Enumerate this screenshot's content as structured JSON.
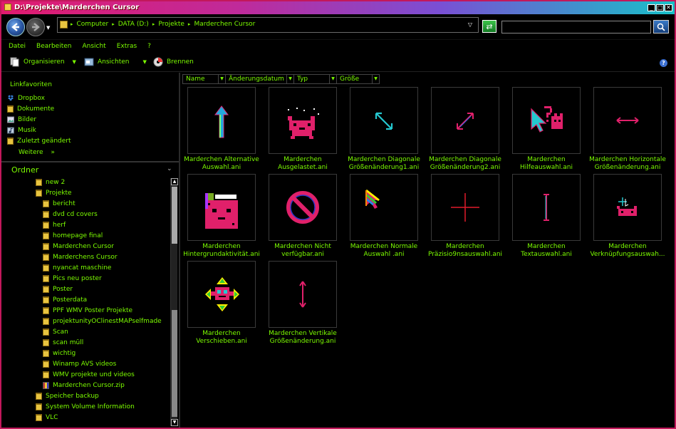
{
  "window": {
    "title": "D:\\Projekte\\Marderchen Cursor",
    "controls": [
      "_",
      "□",
      "✕"
    ]
  },
  "address": {
    "crumbs": [
      "Computer",
      "DATA (D:)",
      "Projekte",
      "Marderchen Cursor"
    ],
    "search_placeholder": ""
  },
  "menu": [
    "Datei",
    "Bearbeiten",
    "Ansicht",
    "Extras",
    "?"
  ],
  "toolbar": {
    "organize": "Organisieren",
    "views": "Ansichten",
    "burn": "Brennen"
  },
  "favorites": {
    "title": "Linkfavoriten",
    "items": [
      "Dropbox",
      "Dokumente",
      "Bilder",
      "Musik",
      "Zuletzt geändert"
    ],
    "more": "Weitere",
    "more_arrow": "»"
  },
  "folders_title": "Ordner",
  "tree": [
    {
      "label": "new 2",
      "level": 1,
      "icon": "folder-icon"
    },
    {
      "label": "Projekte",
      "level": 1,
      "icon": "folder-icon"
    },
    {
      "label": "bericht",
      "level": 2,
      "icon": "folder-icon"
    },
    {
      "label": "dvd cd covers",
      "level": 2,
      "icon": "folder-icon"
    },
    {
      "label": "herf",
      "level": 2,
      "icon": "folder-icon"
    },
    {
      "label": "homepage final",
      "level": 2,
      "icon": "folder-icon"
    },
    {
      "label": "Marderchen Cursor",
      "level": 2,
      "icon": "folder-icon"
    },
    {
      "label": "Marderchens Cursor",
      "level": 2,
      "icon": "folder-icon"
    },
    {
      "label": "nyancat maschine",
      "level": 2,
      "icon": "folder-icon"
    },
    {
      "label": "Pics neu poster",
      "level": 2,
      "icon": "folder-icon"
    },
    {
      "label": "Poster",
      "level": 2,
      "icon": "folder-icon"
    },
    {
      "label": "Posterdata",
      "level": 2,
      "icon": "folder-icon"
    },
    {
      "label": "PPF WMV Poster Projekte",
      "level": 2,
      "icon": "folder-icon"
    },
    {
      "label": "projektunityOClinestMAPselfmade",
      "level": 2,
      "icon": "folder-icon"
    },
    {
      "label": "Scan",
      "level": 2,
      "icon": "folder-icon"
    },
    {
      "label": "scan müll",
      "level": 2,
      "icon": "folder-icon"
    },
    {
      "label": "wichtig",
      "level": 2,
      "icon": "folder-icon"
    },
    {
      "label": "Winamp AVS videos",
      "level": 2,
      "icon": "folder-icon"
    },
    {
      "label": "WMV projekte und videos",
      "level": 2,
      "icon": "folder-icon"
    },
    {
      "label": "Marderchen Cursor.zip",
      "level": 2,
      "icon": "zip-icon"
    },
    {
      "label": "Speicher backup",
      "level": 1,
      "icon": "folder-icon"
    },
    {
      "label": "System Volume Information",
      "level": 1,
      "icon": "folder-icon"
    },
    {
      "label": "VLC",
      "level": 1,
      "icon": "folder-icon"
    }
  ],
  "columns": [
    "Name",
    "Änderungsdatum",
    "Typ",
    "Größe"
  ],
  "files": [
    {
      "line1": "Marderchen Alternative",
      "line2": "Auswahl.ani",
      "icon": "up-arrow-cursor-icon"
    },
    {
      "line1": "Marderchen",
      "line2": "Ausgelastet.ani",
      "icon": "busy-cat-cursor-icon"
    },
    {
      "line1": "Marderchen Diagonale",
      "line2": "Größenänderung1.ani",
      "icon": "diagonal-resize1-icon"
    },
    {
      "line1": "Marderchen Diagonale",
      "line2": "Größenänderung2.ani",
      "icon": "diagonal-resize2-icon"
    },
    {
      "line1": "Marderchen",
      "line2": "Hilfeauswahl.ani",
      "icon": "help-cursor-icon"
    },
    {
      "line1": "Marderchen Horizontale",
      "line2": "Größenänderung.ani",
      "icon": "horizontal-resize-icon"
    },
    {
      "line1": "Marderchen",
      "line2": "Hintergrundaktivität.ani",
      "icon": "background-busy-icon"
    },
    {
      "line1": "Marderchen Nicht",
      "line2": "verfügbar.ani",
      "icon": "not-allowed-icon"
    },
    {
      "line1": "Marderchen Normale",
      "line2": "Auswahl .ani",
      "icon": "normal-select-icon"
    },
    {
      "line1": "Marderchen",
      "line2": "Präzisio9nsauswahl.ani",
      "icon": "precision-crosshair-icon"
    },
    {
      "line1": "Marderchen",
      "line2": "Textauswahl.ani",
      "icon": "text-beam-icon"
    },
    {
      "line1": "Marderchen",
      "line2": "Verknüpfungsauswah...",
      "icon": "link-select-icon"
    },
    {
      "line1": "Marderchen",
      "line2": "Verschieben.ani",
      "icon": "move-cursor-icon"
    },
    {
      "line1": "Marderchen Vertikale",
      "line2": "Größenänderung.ani",
      "icon": "vertical-resize-icon"
    }
  ],
  "colors": {
    "text": "#7CFC00",
    "background": "#000000",
    "accent_pink": "#e0206a",
    "accent_cyan": "#20c8d0"
  }
}
